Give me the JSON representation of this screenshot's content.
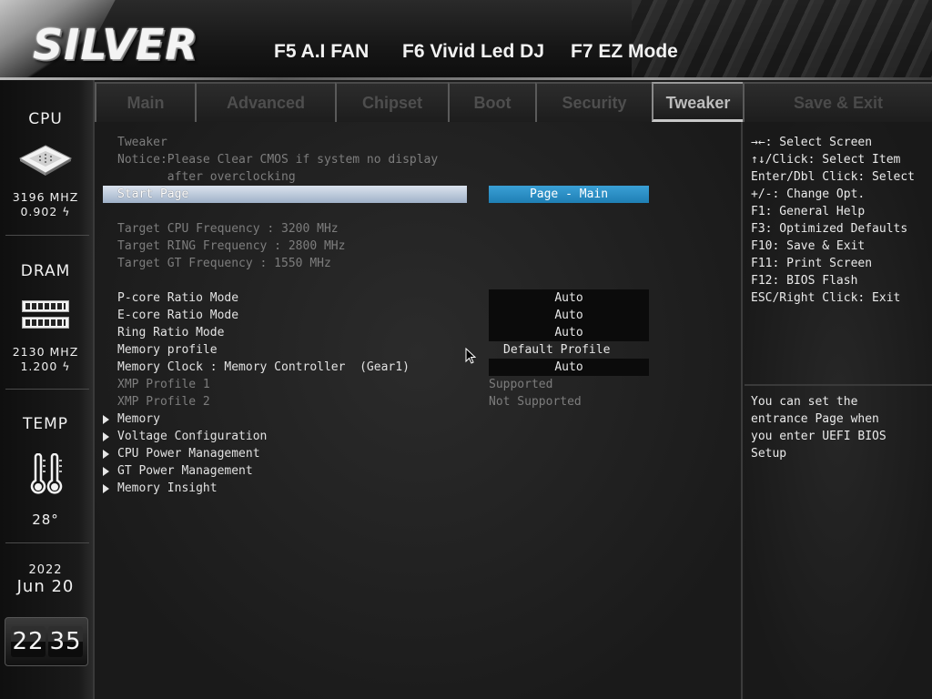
{
  "header": {
    "logo": "SILVER",
    "hotkeys": [
      {
        "label": "F5 A.I FAN"
      },
      {
        "label": "F6 Vivid Led DJ"
      },
      {
        "label": "F7 EZ Mode"
      }
    ]
  },
  "status": {
    "cpu": {
      "title": "CPU",
      "freq": "3196 MHZ",
      "volt": "0.902"
    },
    "dram": {
      "title": "DRAM",
      "freq": "2130 MHZ",
      "volt": "1.200"
    },
    "temp": {
      "title": "TEMP",
      "value": "28°"
    },
    "date": {
      "year": "2022",
      "month": "Jun",
      "day": "20"
    },
    "clock": {
      "hour": "22",
      "minute": "35"
    }
  },
  "tabs": [
    {
      "label": "Main"
    },
    {
      "label": "Advanced"
    },
    {
      "label": "Chipset"
    },
    {
      "label": "Boot"
    },
    {
      "label": "Security"
    },
    {
      "label": "Tweaker",
      "active": true
    },
    {
      "label": "Save & Exit"
    }
  ],
  "main": {
    "section_title": "Tweaker",
    "notice_line1": "Notice:Please Clear CMOS if system no display",
    "notice_line2": "       after overclocking",
    "start_page": {
      "label": "Start Page",
      "value": "Page - Main"
    },
    "targets": [
      "Target CPU Frequency : 3200 MHz",
      "Target RING Frequency : 2800 MHz",
      "Target GT Frequency : 1550 MHz"
    ],
    "settings": [
      {
        "label": "P-core Ratio Mode",
        "value": "Auto"
      },
      {
        "label": "E-core Ratio Mode",
        "value": "Auto"
      },
      {
        "label": "Ring Ratio Mode",
        "value": "Auto"
      },
      {
        "label": "Memory profile",
        "value": "Default Profile"
      },
      {
        "label": "Memory Clock : Memory Controller  (Gear1)",
        "value": "Auto"
      }
    ],
    "xmp": [
      {
        "label": "XMP Profile 1",
        "value": "Supported"
      },
      {
        "label": "XMP Profile 2",
        "value": "Not Supported"
      }
    ],
    "submenus": [
      "Memory",
      "Voltage Configuration",
      "CPU Power Management",
      "GT Power Management",
      "Memory Insight"
    ]
  },
  "help": {
    "keys": [
      "→←: Select Screen",
      "↑↓/Click: Select Item",
      "Enter/Dbl Click: Select",
      "+/-: Change Opt.",
      "F1: General Help",
      "F3: Optimized Defaults",
      "F10: Save & Exit",
      "F11: Print Screen",
      "F12: BIOS Flash",
      "ESC/Right Click: Exit"
    ],
    "description": [
      "You can set the",
      "entrance Page when",
      "you enter UEFI BIOS",
      "Setup"
    ]
  }
}
